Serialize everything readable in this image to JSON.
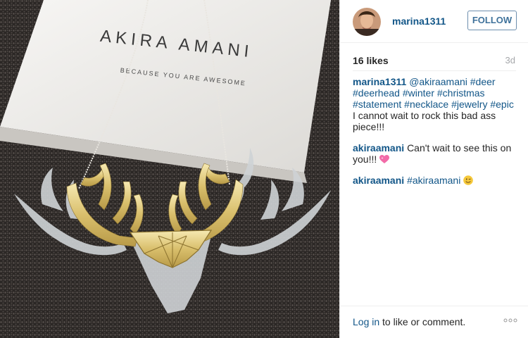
{
  "photo": {
    "box_brand": "AKIRA AMANI",
    "box_tagline": "BECAUSE YOU ARE AWESOME"
  },
  "post": {
    "author": "marina1311",
    "follow_label": "FOLLOW",
    "likes": "16 likes",
    "time_ago": "3d"
  },
  "comments": [
    {
      "user": "marina1311",
      "parts": [
        {
          "type": "tag",
          "text": "@akiraamani"
        },
        {
          "type": "tag",
          "text": "#deer"
        },
        {
          "type": "tag",
          "text": "#deerhead"
        },
        {
          "type": "tag",
          "text": "#winter"
        },
        {
          "type": "tag",
          "text": "#christmas"
        },
        {
          "type": "tag",
          "text": "#statement"
        },
        {
          "type": "tag",
          "text": "#necklace"
        },
        {
          "type": "tag",
          "text": "#jewelry"
        },
        {
          "type": "tag",
          "text": "#epic"
        },
        {
          "type": "text",
          "text": "I cannot wait to rock this bad ass piece!!!"
        }
      ]
    },
    {
      "user": "akiraamani",
      "text": "Can't wait to see this on you!!!",
      "emoji": "sparkling-heart"
    },
    {
      "user": "akiraamani",
      "tag": "#akiraamani",
      "emoji": "winking-face"
    }
  ],
  "footer": {
    "login_label": "Log in",
    "rest_label": " to like or comment."
  },
  "colors": {
    "link": "#125688",
    "follow_border": "#6e8fae",
    "follow_text": "#3f729b",
    "muted": "#a5a7aa"
  }
}
